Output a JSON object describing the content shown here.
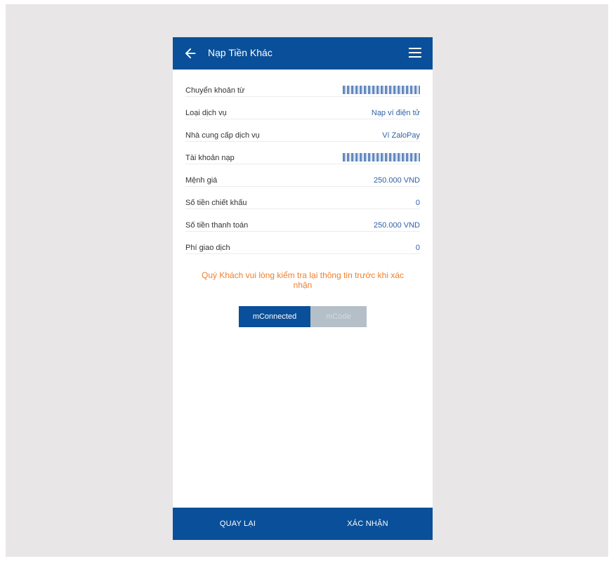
{
  "header": {
    "title": "Nạp Tiền Khác"
  },
  "rows": [
    {
      "label": "Chuyển khoản từ",
      "value": ""
    },
    {
      "label": "Loại dịch vụ",
      "value": "Nạp ví điện tử"
    },
    {
      "label": "Nhà cung cấp dịch vụ",
      "value": "Ví ZaloPay"
    },
    {
      "label": "Tài khoản nạp",
      "value": ""
    },
    {
      "label": "Mệnh giá",
      "value": "250.000 VND"
    },
    {
      "label": "Số tiền chiết khấu",
      "value": "0"
    },
    {
      "label": "Số tiền thanh toán",
      "value": "250.000 VND"
    },
    {
      "label": "Phí giao dịch",
      "value": "0"
    }
  ],
  "note": "Quý Khách vui lòng kiểm tra lại thông tin trước khi xác nhận",
  "auth_switch": {
    "active": "mConnected",
    "inactive": "mCode"
  },
  "footer": {
    "back": "QUAY LẠI",
    "confirm": "XÁC NHẬN"
  },
  "colors": {
    "primary": "#0a4f99",
    "accent": "#ef7f2c",
    "value_text": "#2f62a7"
  }
}
